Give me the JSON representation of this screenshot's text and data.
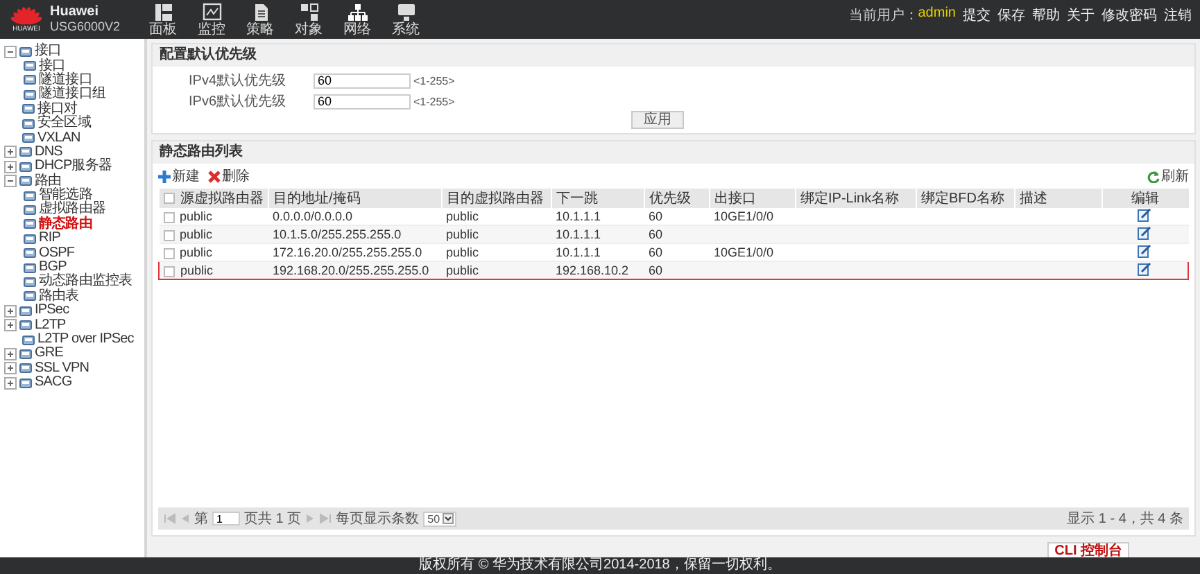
{
  "header": {
    "logo_caption": "HUAWEI",
    "brand": "Huawei",
    "model": "USG6000V2",
    "nav": [
      {
        "label": "面板"
      },
      {
        "label": "监控"
      },
      {
        "label": "策略"
      },
      {
        "label": "对象"
      },
      {
        "label": "网络"
      },
      {
        "label": "系统"
      }
    ],
    "user_label": "当前用户：",
    "user": "admin",
    "links": [
      "提交",
      "保存",
      "帮助",
      "关于",
      "修改密码",
      "注销"
    ]
  },
  "sidebar": {
    "items": [
      {
        "label": "接口",
        "expanded": true,
        "selected": false,
        "children": [
          {
            "label": "接口",
            "selected": false
          },
          {
            "label": "隧道接口",
            "selected": false
          },
          {
            "label": "隧道接口组",
            "selected": false
          }
        ]
      },
      {
        "label": "接口对",
        "selected": false
      },
      {
        "label": "安全区域",
        "selected": false
      },
      {
        "label": "VXLAN",
        "selected": false
      },
      {
        "label": "DNS",
        "expanded": false,
        "selected": false
      },
      {
        "label": "DHCP服务器",
        "expanded": false,
        "selected": false
      },
      {
        "label": "路由",
        "expanded": true,
        "selected": false,
        "children": [
          {
            "label": "智能选路",
            "selected": false
          },
          {
            "label": "虚拟路由器",
            "selected": false
          },
          {
            "label": "静态路由",
            "selected": true
          },
          {
            "label": "RIP",
            "selected": false
          },
          {
            "label": "OSPF",
            "selected": false
          },
          {
            "label": "BGP",
            "selected": false
          },
          {
            "label": "动态路由监控表",
            "selected": false
          },
          {
            "label": "路由表",
            "selected": false
          }
        ]
      },
      {
        "label": "IPSec",
        "expanded": false,
        "selected": false
      },
      {
        "label": "L2TP",
        "expanded": false,
        "selected": false
      },
      {
        "label": "L2TP over IPSec",
        "selected": false
      },
      {
        "label": "GRE",
        "expanded": false,
        "selected": false
      },
      {
        "label": "SSL VPN",
        "expanded": false,
        "selected": false
      },
      {
        "label": "SACG",
        "expanded": false,
        "selected": false
      }
    ]
  },
  "priority_panel": {
    "title": "配置默认优先级",
    "fields": [
      {
        "label": "IPv4默认优先级",
        "value": "60",
        "range": "<1-255>"
      },
      {
        "label": "IPv6默认优先级",
        "value": "60",
        "range": "<1-255>"
      }
    ],
    "apply": "应用"
  },
  "routes_panel": {
    "title": "静态路由列表",
    "new": "新建",
    "delete": "删除",
    "refresh": "刷新",
    "columns": [
      "源虚拟路由器",
      "目的地址/掩码",
      "目的虚拟路由器",
      "下一跳",
      "优先级",
      "出接口",
      "绑定IP-Link名称",
      "绑定BFD名称",
      "描述",
      "编辑"
    ],
    "all_checked": false,
    "rows": [
      {
        "checked": false,
        "highlighted": false,
        "cells": [
          "public",
          "0.0.0.0/0.0.0.0",
          "public",
          "10.1.1.1",
          "60",
          "10GE1/0/0"
        ]
      },
      {
        "checked": false,
        "highlighted": false,
        "cells": [
          "public",
          "10.1.5.0/255.255.255.0",
          "public",
          "10.1.1.1",
          "60",
          ""
        ]
      },
      {
        "checked": false,
        "highlighted": false,
        "cells": [
          "public",
          "172.16.20.0/255.255.255.0",
          "public",
          "10.1.1.1",
          "60",
          "10GE1/0/0"
        ]
      },
      {
        "checked": false,
        "highlighted": true,
        "cells": [
          "public",
          "192.168.20.0/255.255.255.0",
          "public",
          "192.168.10.2",
          "60",
          ""
        ]
      }
    ],
    "pager": {
      "page_prefix": "第",
      "page": "1",
      "page_suffix": "页共 1 页",
      "per_page_label": "每页显示条数",
      "per_page": "50",
      "summary": "显示 1 - 4，共 4 条"
    }
  },
  "cli_tab": "CLI 控制台",
  "footer": "版权所有 © 华为技术有限公司2014-2018，保留一切权利。"
}
